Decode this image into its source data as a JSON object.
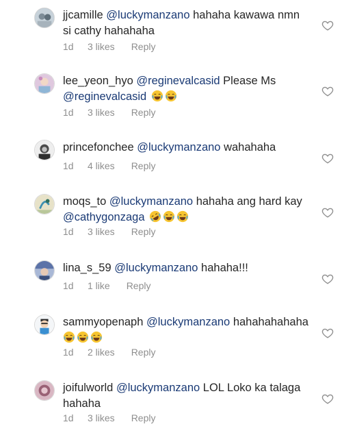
{
  "comments": [
    {
      "username": "jjcamille",
      "mention": "@luckymanzano",
      "text": " hahaha kawawa nmn\nsi cathy hahahaha",
      "time": "1d",
      "likes": "3 likes",
      "reply": "Reply",
      "avatar_icon": "photo-avatar-icon",
      "avatar_color": "#9aa7b2",
      "emojis": []
    },
    {
      "username": "lee_yeon_hyo",
      "mention": "@reginevalcasid",
      "text": " Please Ms ",
      "mention2": "@reginevalcasid",
      "time": "1d",
      "likes": "3 likes",
      "reply": "Reply",
      "avatar_icon": "photo-avatar-icon",
      "avatar_color": "#c9a6c7",
      "emojis": [
        "crying-laughing-emoji-icon",
        "crying-laughing-emoji-icon"
      ]
    },
    {
      "username": "princefonchee",
      "mention": "@luckymanzano",
      "text": " wahahaha",
      "time": "1d",
      "likes": "4 likes",
      "reply": "Reply",
      "avatar_icon": "photo-avatar-icon",
      "avatar_color": "#6b6b6b",
      "emojis": []
    },
    {
      "username": "moqs_to",
      "mention": "@luckymanzano",
      "text": " hahaha ang hard kay\n",
      "mention2": "@cathygonzaga",
      "time": "1d",
      "likes": "3 likes",
      "reply": "Reply",
      "avatar_icon": "photo-avatar-icon",
      "avatar_color": "#9bb7a3",
      "emojis": [
        "rolling-laughing-emoji-icon",
        "crying-laughing-emoji-icon",
        "crying-laughing-emoji-icon"
      ]
    },
    {
      "username": "lina_s_59",
      "mention": "@luckymanzano",
      "text": " hahaha!!!",
      "time": "1d",
      "likes": "1 like",
      "reply": "Reply",
      "avatar_icon": "photo-avatar-icon",
      "avatar_color": "#7b8fb5",
      "emojis": []
    },
    {
      "username": "sammyopenaph",
      "mention": "@luckymanzano",
      "text": " hahahahahaha\n",
      "time": "1d",
      "likes": "2 likes",
      "reply": "Reply",
      "avatar_icon": "cartoon-avatar-icon",
      "avatar_color": "#e8eef3",
      "emojis": [
        "crying-laughing-emoji-icon",
        "crying-laughing-emoji-icon",
        "crying-laughing-emoji-icon"
      ]
    },
    {
      "username": "joifulworld",
      "mention": "@luckymanzano",
      "text": " LOL Loko ka talaga\nhahaha",
      "time": "1d",
      "likes": "3 likes",
      "reply": "Reply",
      "avatar_icon": "photo-avatar-icon",
      "avatar_color": "#b8869a",
      "emojis": []
    }
  ],
  "colors": {
    "text": "#262626",
    "mention": "#1a3a75",
    "meta": "#8e8e8e",
    "heart": "#8e8e8e"
  }
}
